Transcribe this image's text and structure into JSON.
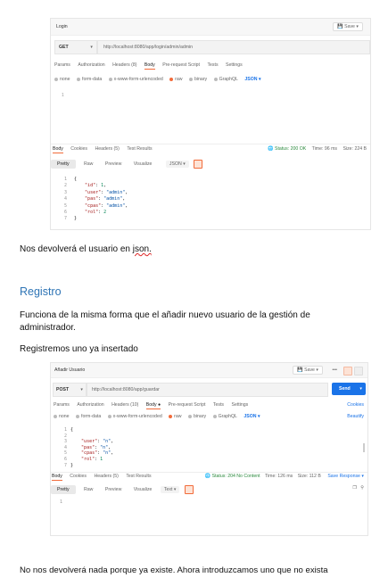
{
  "shot1": {
    "request_name": "Login",
    "save_label": "Save",
    "method": "GET",
    "url": "http://localhost:8080/app/login/admin/admin",
    "request_tabs": [
      "Params",
      "Authorization",
      "Headers (8)",
      "Body",
      "Pre-request Script",
      "Tests",
      "Settings"
    ],
    "body_options": [
      "none",
      "form-data",
      "x-www-form-urlencoded",
      "raw",
      "binary",
      "GraphQL"
    ],
    "body_format": "JSON",
    "request_body_line": "1",
    "response_tabs": [
      "Body",
      "Cookies",
      "Headers (5)",
      "Test Results"
    ],
    "status": "Status: 200 OK",
    "time": "Time: 96 ms",
    "size": "Size: 224 B",
    "view_tabs": [
      "Pretty",
      "Raw",
      "Preview",
      "Visualize"
    ],
    "view_format": "JSON",
    "response_lines": [
      "1",
      "2",
      "3",
      "4",
      "5",
      "6",
      "7"
    ],
    "response_code": {
      "l1": "{",
      "k_id": "\"id\"",
      "v_id": "1",
      "k_user": "\"user\"",
      "v_user": "\"admin\"",
      "k_pas": "\"pas\"",
      "v_pas": "\"admin\"",
      "k_cpas": "\"cpas\"",
      "v_cpas": "\"admin\"",
      "k_rol": "\"rol\"",
      "v_rol": "2",
      "l7": "}"
    }
  },
  "doc": {
    "para1_a": "Nos devolverá el usuario en ",
    "para1_b": "json.",
    "heading": "Registro",
    "para2_l1": "Funciona de la misma forma que el añadir nuevo usuario de la gestión de",
    "para2_l2": "administrador.",
    "para3": "Registremos uno ya insertado",
    "para4": "No nos devolverá nada porque ya existe. Ahora introduzcamos uno que no exista"
  },
  "shot2": {
    "request_name": "Añadir Usuario",
    "save_label": "Save",
    "more_label": "•••",
    "method": "POST",
    "url": "http://localhost:8080/app/guardar",
    "send_label": "Send",
    "request_tabs": [
      "Params",
      "Authorization",
      "Headers (10)",
      "Body ●",
      "Pre-request Script",
      "Tests",
      "Settings"
    ],
    "cookies_label": "Cookies",
    "body_options": [
      "none",
      "form-data",
      "x-www-form-urlencoded",
      "raw",
      "binary",
      "GraphQL"
    ],
    "body_format": "JSON",
    "beautify_label": "Beautify",
    "request_lines": [
      "1",
      "2",
      "3",
      "4",
      "5",
      "6",
      "7"
    ],
    "request_code": {
      "l1": "{",
      "k_user": "\"user\"",
      "v_user": "\"n\"",
      "k_pas": "\"pas\"",
      "v_pas": "\"n\"",
      "k_cpas": "\"cpas\"",
      "v_cpas": "\"n\"",
      "k_rol": "\"rol\"",
      "v_rol": "1",
      "l7": "}"
    },
    "response_tabs": [
      "Body",
      "Cookies",
      "Headers (5)",
      "Test Results"
    ],
    "status": "Status: 204 No Content",
    "time": "Time: 126 ms",
    "size": "Size: 112 B",
    "save_response": "Save Response",
    "view_tabs": [
      "Pretty",
      "Raw",
      "Preview",
      "Visualize"
    ],
    "view_format": "Text",
    "response_line": "1"
  },
  "colors": {
    "accent": "#f26b3a",
    "send": "#1a73e8",
    "heading": "#2e74b5",
    "status_ok": "#2c8a3e"
  }
}
